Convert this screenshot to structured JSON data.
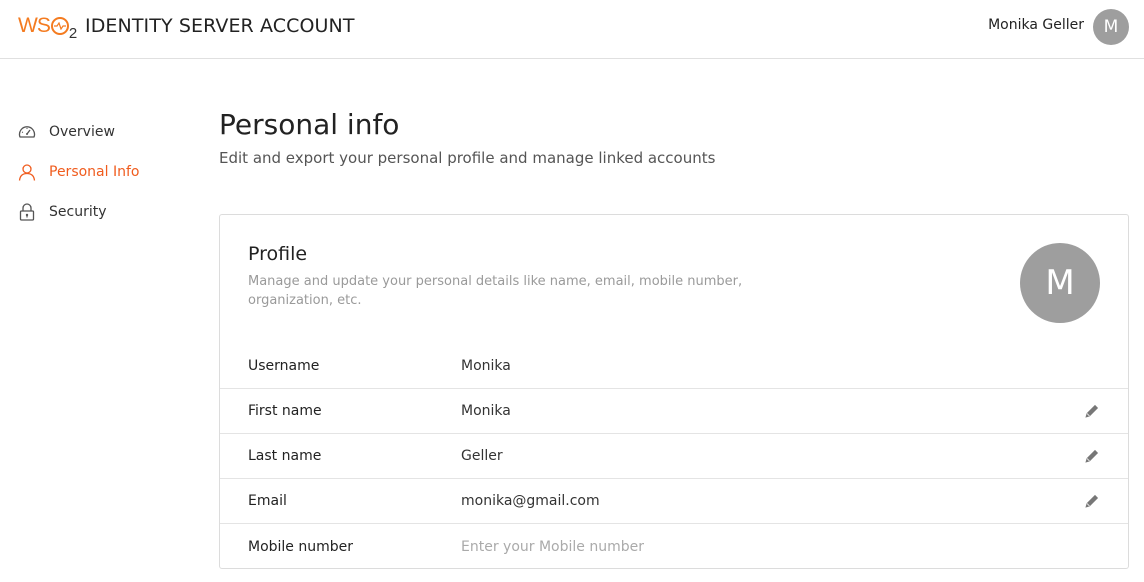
{
  "header": {
    "logo_text": "WS",
    "logo_sub": "2",
    "title": "IDENTITY SERVER ACCOUNT",
    "user_name": "Monika Geller",
    "avatar_initial": "M"
  },
  "sidebar": {
    "items": [
      {
        "label": "Overview",
        "icon": "dashboard-icon",
        "active": false
      },
      {
        "label": "Personal Info",
        "icon": "user-icon",
        "active": true
      },
      {
        "label": "Security",
        "icon": "lock-icon",
        "active": false
      }
    ]
  },
  "main": {
    "title": "Personal info",
    "subtitle": "Edit and export your personal profile and manage linked accounts"
  },
  "profile": {
    "title": "Profile",
    "description": "Manage and update your personal details like name, email, mobile number, organization, etc.",
    "avatar_initial": "M",
    "rows": [
      {
        "label": "Username",
        "value": "Monika",
        "editable": false
      },
      {
        "label": "First name",
        "value": "Monika",
        "editable": true
      },
      {
        "label": "Last name",
        "value": "Geller",
        "editable": true
      },
      {
        "label": "Email",
        "value": "monika@gmail.com",
        "editable": true
      },
      {
        "label": "Mobile number",
        "value": "",
        "placeholder": "Enter your Mobile number",
        "editable": false
      }
    ]
  },
  "colors": {
    "accent": "#f05c1e",
    "logo": "#f47b20",
    "avatar": "#9e9e9e"
  }
}
